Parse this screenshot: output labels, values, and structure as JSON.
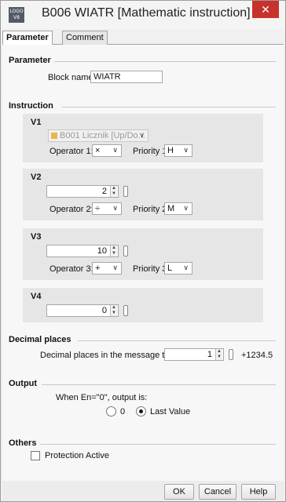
{
  "window": {
    "logo_text": "LOGO V8",
    "title": "B006 WIATR [Mathematic instruction]",
    "close": "✕"
  },
  "tabs": [
    {
      "label": "Parameter",
      "active": true
    },
    {
      "label": "Comment",
      "active": false
    }
  ],
  "parameter": {
    "section": "Parameter",
    "block_name_label": "Block name:",
    "block_name_value": "WIATR"
  },
  "instruction": {
    "section": "Instruction",
    "v1": {
      "title": "V1",
      "block_ref": "B001 Licznik [Up/Do...",
      "operator_label": "Operator 1:",
      "operator": "×",
      "priority_label": "Priority 1:",
      "priority": "H"
    },
    "v2": {
      "title": "V2",
      "value": "2",
      "operator_label": "Operator 2:",
      "operator": "÷",
      "priority_label": "Priority 2:",
      "priority": "M"
    },
    "v3": {
      "title": "V3",
      "value": "10",
      "operator_label": "Operator 3:",
      "operator": "+",
      "priority_label": "Priority 3:",
      "priority": "L"
    },
    "v4": {
      "title": "V4",
      "value": "0"
    }
  },
  "decimal": {
    "section": "Decimal places",
    "label": "Decimal places in the message text:",
    "value": "1",
    "preview": "+1234.5"
  },
  "output": {
    "section": "Output",
    "label": "When En=\"0\", output is:",
    "option_zero": "0",
    "option_last": "Last Value",
    "selected": "Last Value"
  },
  "others": {
    "section": "Others",
    "protection_label": "Protection Active",
    "protection_checked": false
  },
  "buttons": {
    "ok": "OK",
    "cancel": "Cancel",
    "help": "Help"
  }
}
